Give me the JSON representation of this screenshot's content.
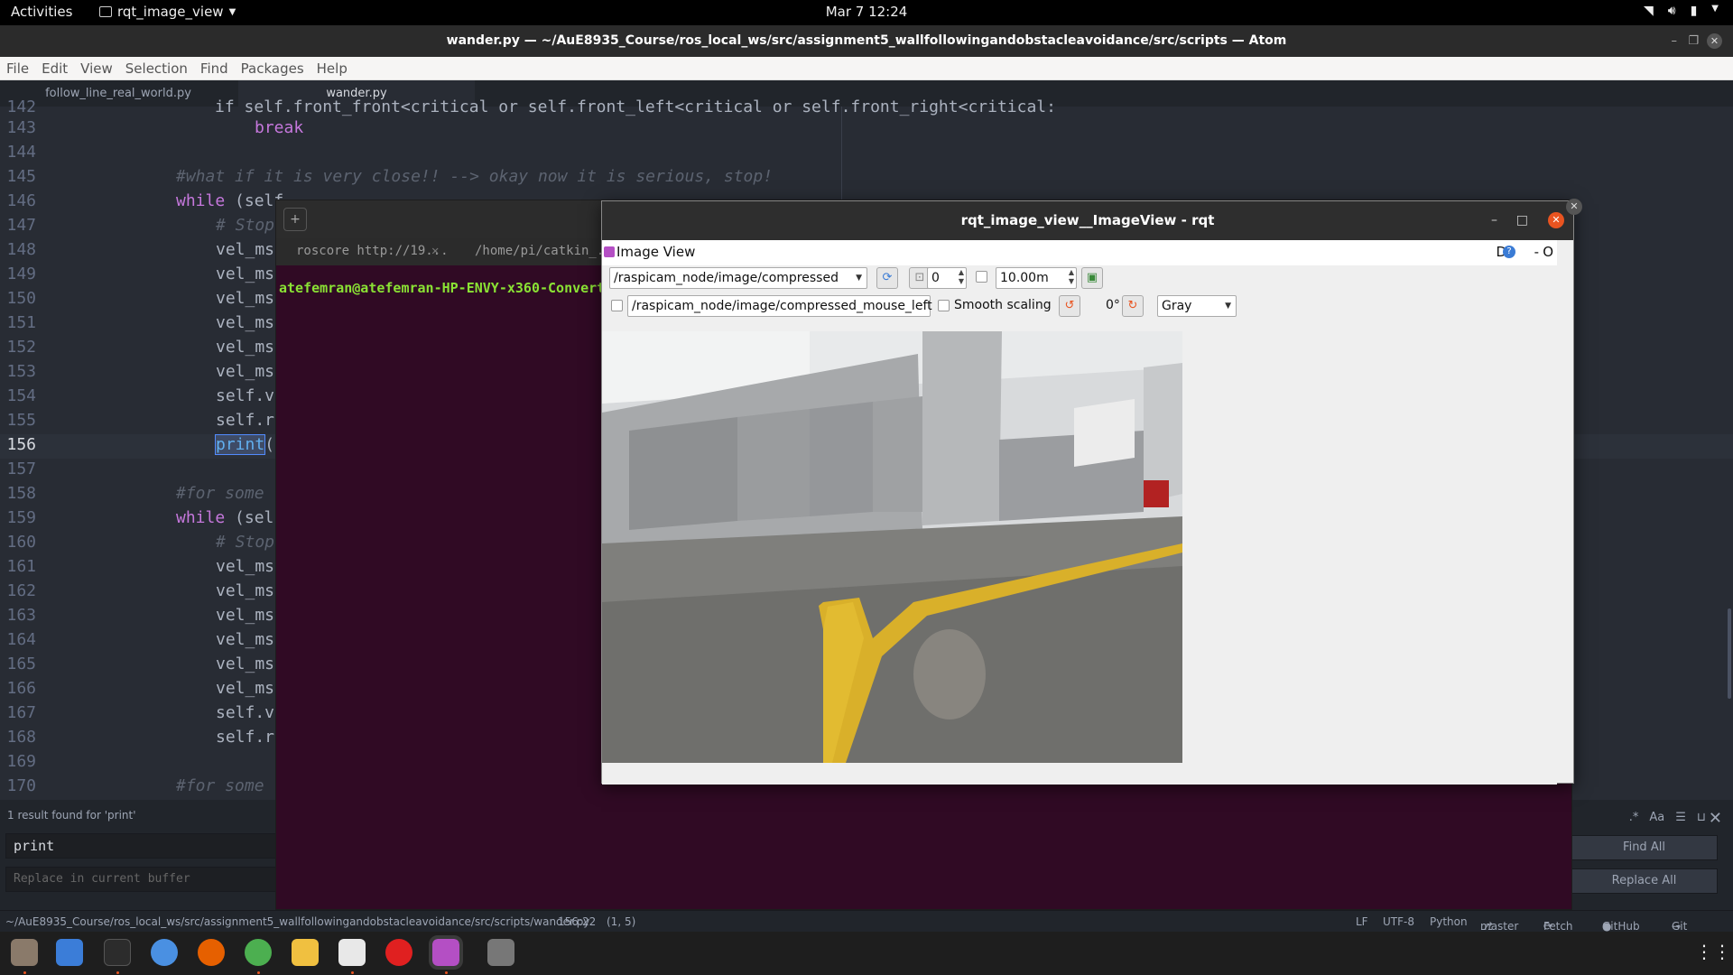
{
  "topbar": {
    "activities": "Activities",
    "app_menu": "rqt_image_view",
    "clock": "Mar 7  12:24",
    "icons": [
      "wifi-icon",
      "volume-icon",
      "battery-icon",
      "power-menu-icon"
    ]
  },
  "atom": {
    "title": "wander.py — ~/AuE8935_Course/ros_local_ws/src/assignment5_wallfollowingandobstacleavoidance/src/scripts — Atom",
    "menu": [
      "File",
      "Edit",
      "View",
      "Selection",
      "Find",
      "Packages",
      "Help"
    ],
    "tabs": [
      {
        "label": "follow_line_real_world.py",
        "active": false
      },
      {
        "label": "wander.py",
        "active": true
      }
    ],
    "line_numbers": [
      "142",
      "143",
      "144",
      "145",
      "146",
      "147",
      "148",
      "149",
      "150",
      "151",
      "152",
      "153",
      "154",
      "155",
      "156",
      "157",
      "158",
      "159",
      "160",
      "161",
      "162",
      "163",
      "164",
      "165",
      "166",
      "167",
      "168",
      "169",
      "170"
    ],
    "current_line": "156",
    "code": {
      "l142": "if self.front_front<critical or self.front_left<critical or self.front_right<critical:",
      "l143": "break",
      "l145": "#what if it is very close!! --> okay now it is serious, stop!",
      "l146_kw": "while",
      "l146": " (self",
      "l147": "# Stop",
      "vel": "vel_msg",
      "self_v": "self.ve",
      "self_r": "self.ra",
      "print_kw": "print",
      "print_rest": "(",
      "l158": "#for some",
      "l159_kw": "while",
      "l159": " (self",
      "l160": "# Stop",
      "l170": "#for some"
    },
    "find": {
      "result": "1 result found for 'print'",
      "find_value": "print",
      "replace_placeholder": "Replace in current buffer",
      "find_all": "Find All",
      "replace_all": "Replace All",
      "option_icons": [
        "regex-icon",
        "case-sensitive-icon",
        "in-selection-icon",
        "whole-word-icon"
      ]
    },
    "status": {
      "path": "~/AuE8935_Course/ros_local_ws/src/assignment5_wallfollowingandobstacleavoidance/src/scripts/wander.py",
      "cursor": "156:22",
      "selection": "(1, 5)",
      "eol": "LF",
      "encoding": "UTF-8",
      "grammar": "Python",
      "branch": "master",
      "fetch": "Fetch",
      "github": "GitHub",
      "git": "Git (14)"
    }
  },
  "terminal": {
    "tabs": [
      "roscore http://19...",
      "/home/pi/catkin_..."
    ],
    "prompt": "atefemran@atefemran-HP-ENVY-x360-Convert"
  },
  "rqt": {
    "title": "rqt_image_view__ImageView - rqt",
    "panel_title": "Image View",
    "panel_controls": "D",
    "panel_minus": "-",
    "panel_o": "O",
    "topic": "/raspicam_node/image/compressed",
    "zoom_value": "0",
    "max_range": "10.00m",
    "mouse_topic": "/raspicam_node/image/compressed_mouse_left",
    "smooth_scaling": "Smooth scaling",
    "rotation": "0°",
    "color_scheme": "Gray",
    "colors": {
      "accent_orange": "#e95420",
      "terminal_bg": "#300a24",
      "editor_bg": "#282c34"
    }
  },
  "dock": {
    "apps": [
      "files-icon",
      "text-editor-icon",
      "terminal-icon",
      "chromium-icon",
      "firefox-icon",
      "browser-icon",
      "calculator-icon",
      "store-icon",
      "warning-icon",
      "rqt-icon",
      "disk-icon",
      "show-apps-icon"
    ]
  }
}
